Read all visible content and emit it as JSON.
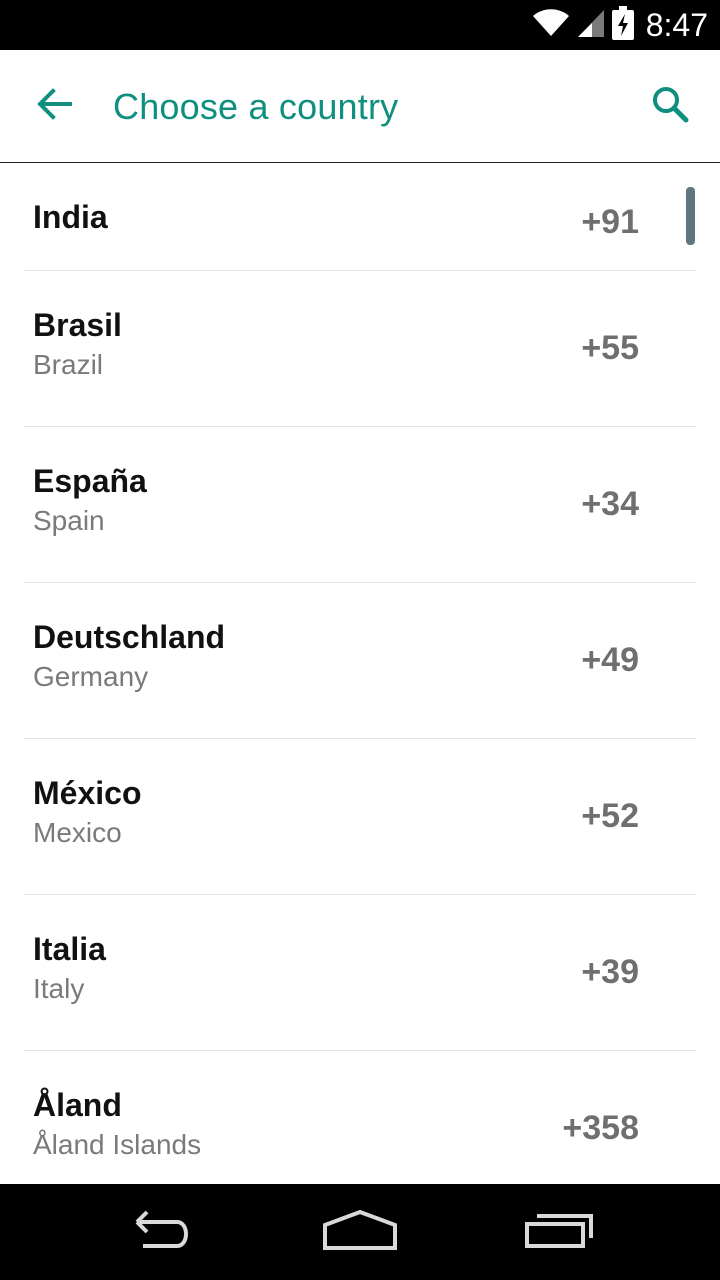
{
  "status_bar": {
    "time": "8:47",
    "icons": [
      "wifi-icon",
      "cell-signal-icon",
      "battery-charging-icon"
    ]
  },
  "app_bar": {
    "title": "Choose a country",
    "back_icon": "arrow-back-icon",
    "search_icon": "search-icon",
    "accent_color": "#0f8f7e"
  },
  "countries": [
    {
      "native": "India",
      "english": "",
      "code": "+91"
    },
    {
      "native": "Brasil",
      "english": "Brazil",
      "code": "+55"
    },
    {
      "native": "España",
      "english": "Spain",
      "code": "+34"
    },
    {
      "native": "Deutschland",
      "english": "Germany",
      "code": "+49"
    },
    {
      "native": "México",
      "english": "Mexico",
      "code": "+52"
    },
    {
      "native": "Italia",
      "english": "Italy",
      "code": "+39"
    },
    {
      "native": "Åland",
      "english": "Åland Islands",
      "code": "+358"
    }
  ],
  "nav_bar": {
    "icons": [
      "back-nav-icon",
      "home-nav-icon",
      "recents-nav-icon"
    ]
  }
}
